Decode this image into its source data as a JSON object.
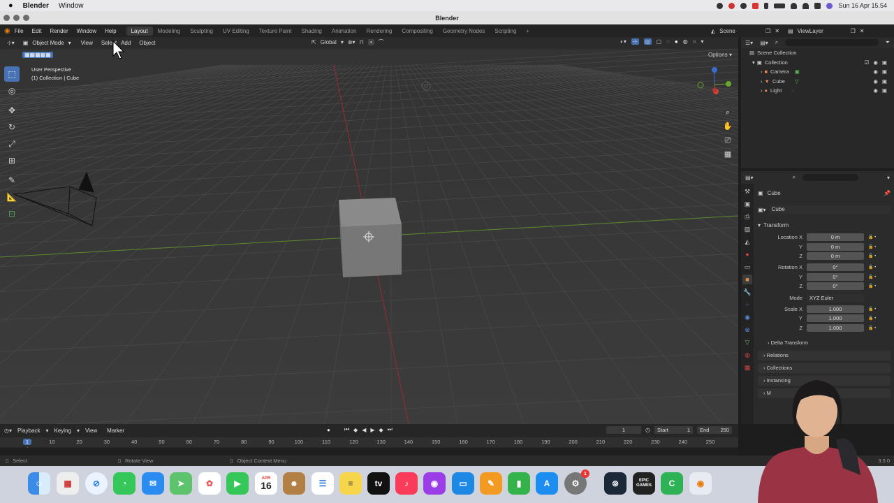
{
  "macos": {
    "app_name": "Blender",
    "menus": [
      "Window"
    ],
    "clock": "Sun 16 Apr  15.54"
  },
  "window": {
    "title": "Blender"
  },
  "topbar": {
    "menus": [
      "File",
      "Edit",
      "Render",
      "Window",
      "Help"
    ],
    "workspaces": [
      "Layout",
      "Modeling",
      "Sculpting",
      "UV Editing",
      "Texture Paint",
      "Shading",
      "Animation",
      "Rendering",
      "Compositing",
      "Geometry Nodes",
      "Scripting"
    ],
    "add_tab": "+",
    "scene": "Scene",
    "view_layer": "ViewLayer"
  },
  "viewport": {
    "mode": "Object Mode",
    "menus": [
      "View",
      "Select",
      "Add",
      "Object"
    ],
    "orientation": "Global",
    "options": "Options",
    "perspective": "User Perspective",
    "context": "(1) Collection | Cube",
    "tools": [
      "select-box",
      "cursor",
      "move",
      "rotate",
      "scale",
      "transform",
      "annotate",
      "measure",
      "add-cube"
    ]
  },
  "outliner": {
    "root": "Scene Collection",
    "collection": "Collection",
    "items": [
      "Camera",
      "Cube",
      "Light"
    ]
  },
  "properties": {
    "object_header": "Cube",
    "object_name": "Cube",
    "transform_title": "Transform",
    "location": {
      "label": "Location X",
      "x": "0 m",
      "y": "0 m",
      "z": "0 m"
    },
    "rotation": {
      "label": "Rotation X",
      "x": "0°",
      "y": "0°",
      "z": "0°"
    },
    "mode_label": "Mode",
    "mode_value": "XYZ Euler",
    "scale": {
      "label": "Scale X",
      "x": "1.000",
      "y": "1.000",
      "z": "1.000"
    },
    "axis_y": "Y",
    "axis_z": "Z",
    "sections": [
      "Delta Transform",
      "Relations",
      "Collections",
      "Instancing"
    ],
    "truncated_section": "M"
  },
  "timeline": {
    "menus": [
      "Playback",
      "Keying",
      "View",
      "Marker"
    ],
    "current_frame": "1",
    "start_label": "Start",
    "start": "1",
    "end_label": "End",
    "end": "250",
    "ticks": [
      "1",
      "10",
      "20",
      "30",
      "40",
      "50",
      "60",
      "70",
      "80",
      "90",
      "100",
      "110",
      "120",
      "130",
      "140",
      "150",
      "160",
      "170",
      "180",
      "190",
      "200",
      "210",
      "220",
      "230",
      "240",
      "250"
    ]
  },
  "statusbar": {
    "hints": [
      "Select",
      "Rotate View",
      "Object Context Menu"
    ],
    "version": "3.5.0"
  },
  "dock": {
    "calendar_month": "APR",
    "calendar_day": "16",
    "appletv": "tv",
    "epic": "EPIC GAMES",
    "badge": "1"
  },
  "colors": {
    "active_blue": "#4772b3",
    "x_axis": "#9a2b34",
    "y_axis": "#5e8a2e",
    "cube": "#7a7a7a"
  }
}
